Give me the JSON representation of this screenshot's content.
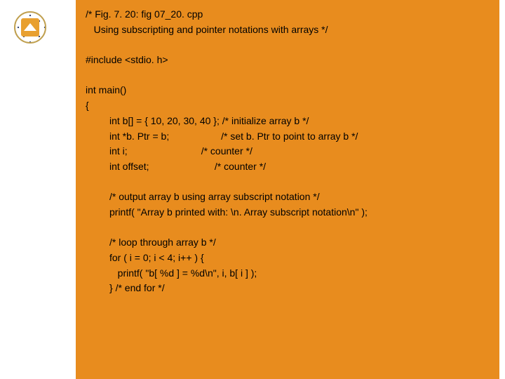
{
  "code": {
    "l1": "/* Fig. 7. 20: fig 07_20. cpp",
    "l2": "   Using subscripting and pointer notations with arrays */",
    "l3": "#include <stdio. h>",
    "l4": "int main()",
    "l5": "{",
    "l6": "int b[] = { 10, 20, 30, 40 }; /* initialize array b */",
    "l7": "int *b. Ptr = b;                   /* set b. Ptr to point to array b */",
    "l8": "int i;                           /* counter */",
    "l9": "int offset;                        /* counter */",
    "l10": "/* output array b using array subscript notation */",
    "l11": "printf( \"Array b printed with: \\n. Array subscript notation\\n\" );",
    "l12": "/* loop through array b */",
    "l13": "for ( i = 0; i < 4; i++ ) {",
    "l14": "   printf( \"b[ %d ] = %d\\n\", i, b[ i ] ); ",
    "l15": "} /* end for */"
  }
}
